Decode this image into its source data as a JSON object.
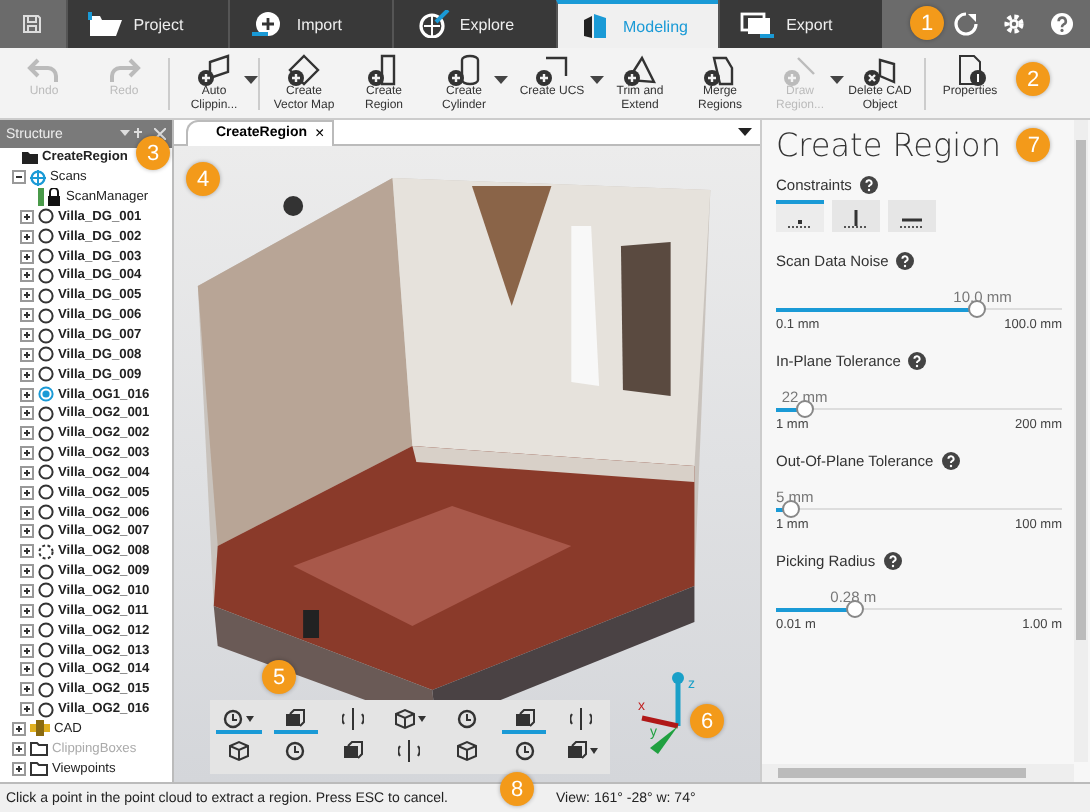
{
  "nav": {
    "tabs": [
      {
        "label": "Project",
        "selected": false
      },
      {
        "label": "Import",
        "selected": false
      },
      {
        "label": "Explore",
        "selected": false
      },
      {
        "label": "Modeling",
        "selected": true
      },
      {
        "label": "Export",
        "selected": false
      }
    ],
    "badge": "1"
  },
  "ribbon": {
    "buttons": [
      {
        "label": "Undo",
        "disabled": true,
        "dropdown": false
      },
      {
        "label": "Redo",
        "disabled": true,
        "dropdown": false
      },
      {
        "label": "Auto Clippin...",
        "disabled": false,
        "dropdown": true
      },
      {
        "label": "Create Vector Map",
        "disabled": false,
        "dropdown": false
      },
      {
        "label": "Create Region",
        "disabled": false,
        "dropdown": false
      },
      {
        "label": "Create Cylinder",
        "disabled": false,
        "dropdown": true
      },
      {
        "label": "Create UCS",
        "disabled": false,
        "dropdown": true
      },
      {
        "label": "Trim and Extend",
        "disabled": false,
        "dropdown": false
      },
      {
        "label": "Merge Regions",
        "disabled": false,
        "dropdown": false
      },
      {
        "label": "Draw Region...",
        "disabled": true,
        "dropdown": true
      },
      {
        "label": "Delete CAD Object",
        "disabled": false,
        "dropdown": false
      },
      {
        "label": "Properties",
        "disabled": false,
        "dropdown": false
      }
    ],
    "badge": "2"
  },
  "structure": {
    "title": "Structure",
    "badge": "3",
    "tree": [
      {
        "label": "CreateRegion",
        "kind": "root",
        "children": [
          {
            "label": "Scans",
            "kind": "group",
            "expanded": true,
            "children": [
              {
                "label": "ScanManager",
                "kind": "manager"
              },
              {
                "label": "Villa_DG_001",
                "kind": "scan",
                "selected": false,
                "loaded": true,
                "expanded": false
              },
              {
                "label": "Villa_DG_002",
                "kind": "scan",
                "selected": false,
                "loaded": true,
                "expanded": false
              },
              {
                "label": "Villa_DG_003",
                "kind": "scan",
                "selected": false,
                "loaded": true,
                "expanded": false
              },
              {
                "label": "Villa_DG_004",
                "kind": "scan",
                "selected": false,
                "loaded": true,
                "expanded": false
              },
              {
                "label": "Villa_DG_005",
                "kind": "scan",
                "selected": false,
                "loaded": true,
                "expanded": false
              },
              {
                "label": "Villa_DG_006",
                "kind": "scan",
                "selected": false,
                "loaded": true,
                "expanded": false
              },
              {
                "label": "Villa_DG_007",
                "kind": "scan",
                "selected": false,
                "loaded": true,
                "expanded": false
              },
              {
                "label": "Villa_DG_008",
                "kind": "scan",
                "selected": false,
                "loaded": true,
                "expanded": false
              },
              {
                "label": "Villa_DG_009",
                "kind": "scan",
                "selected": false,
                "loaded": true,
                "expanded": false
              },
              {
                "label": "Villa_OG1_016",
                "kind": "scan",
                "selected": true,
                "loaded": true,
                "expanded": false
              },
              {
                "label": "Villa_OG2_001",
                "kind": "scan",
                "selected": false,
                "loaded": true,
                "expanded": false
              },
              {
                "label": "Villa_OG2_002",
                "kind": "scan",
                "selected": false,
                "loaded": true,
                "expanded": false
              },
              {
                "label": "Villa_OG2_003",
                "kind": "scan",
                "selected": false,
                "loaded": true,
                "expanded": false
              },
              {
                "label": "Villa_OG2_004",
                "kind": "scan",
                "selected": false,
                "loaded": true,
                "expanded": false
              },
              {
                "label": "Villa_OG2_005",
                "kind": "scan",
                "selected": false,
                "loaded": true,
                "expanded": false
              },
              {
                "label": "Villa_OG2_006",
                "kind": "scan",
                "selected": false,
                "loaded": true,
                "expanded": false
              },
              {
                "label": "Villa_OG2_007",
                "kind": "scan",
                "selected": false,
                "loaded": true,
                "expanded": false
              },
              {
                "label": "Villa_OG2_008",
                "kind": "scan",
                "selected": false,
                "loaded": false,
                "expanded": false
              },
              {
                "label": "Villa_OG2_009",
                "kind": "scan",
                "selected": false,
                "loaded": true,
                "expanded": false
              },
              {
                "label": "Villa_OG2_010",
                "kind": "scan",
                "selected": false,
                "loaded": true,
                "expanded": false
              },
              {
                "label": "Villa_OG2_011",
                "kind": "scan",
                "selected": false,
                "loaded": true,
                "expanded": false
              },
              {
                "label": "Villa_OG2_012",
                "kind": "scan",
                "selected": false,
                "loaded": true,
                "expanded": false
              },
              {
                "label": "Villa_OG2_013",
                "kind": "scan",
                "selected": false,
                "loaded": true,
                "expanded": false
              },
              {
                "label": "Villa_OG2_014",
                "kind": "scan",
                "selected": false,
                "loaded": true,
                "expanded": false
              },
              {
                "label": "Villa_OG2_015",
                "kind": "scan",
                "selected": false,
                "loaded": true,
                "expanded": false
              },
              {
                "label": "Villa_OG2_016",
                "kind": "scan",
                "selected": false,
                "loaded": true,
                "expanded": false
              }
            ]
          },
          {
            "label": "CAD",
            "kind": "cad",
            "expanded": false
          },
          {
            "label": "ClippingBoxes",
            "kind": "folder",
            "expanded": false,
            "disabled": true
          },
          {
            "label": "Viewpoints",
            "kind": "folder",
            "expanded": false
          }
        ]
      }
    ]
  },
  "viewport": {
    "tab": {
      "label": "CreateRegion",
      "close": "×"
    },
    "badge": "4",
    "toolbar_badge": "5",
    "axes_badge": "6",
    "axes": {
      "x": "x",
      "y": "y",
      "z": "z"
    },
    "tools": [
      {
        "active": true,
        "dropdown": true
      },
      {
        "active": true,
        "dropdown": false
      },
      {
        "active": false,
        "dropdown": false
      },
      {
        "active": false,
        "dropdown": true
      },
      {
        "active": false,
        "dropdown": false
      },
      {
        "active": true,
        "dropdown": false
      },
      {
        "active": false,
        "dropdown": false
      },
      {
        "active": false,
        "dropdown": false
      },
      {
        "active": false,
        "dropdown": false
      },
      {
        "active": false,
        "dropdown": false
      },
      {
        "active": false,
        "dropdown": false
      },
      {
        "active": false,
        "dropdown": false
      },
      {
        "active": false,
        "dropdown": false
      },
      {
        "active": false,
        "dropdown": true
      }
    ]
  },
  "panel": {
    "title": "Create Region",
    "badge": "7",
    "constraints": {
      "label": "Constraints",
      "options": [
        {
          "selected": true
        },
        {
          "selected": false
        },
        {
          "selected": false
        }
      ]
    },
    "sliders": [
      {
        "label": "Scan Data Noise",
        "reading": "10.0 mm",
        "level": 0.7,
        "min": "0.1 mm",
        "max": "100.0 mm"
      },
      {
        "label": "In-Plane Tolerance",
        "reading": "22 mm",
        "level": 0.1,
        "min": "1 mm",
        "max": "200 mm"
      },
      {
        "label": "Out-Of-Plane Tolerance",
        "reading": "5 mm",
        "level": 0.05,
        "min": "1 mm",
        "max": "100 mm"
      },
      {
        "label": "Picking Radius",
        "reading": "0.28 m",
        "level": 0.27,
        "min": "0.01 m",
        "max": "1.00 m"
      }
    ]
  },
  "status_bar": {
    "message": "Click a point in the point cloud to extract a region. Press ESC to cancel.",
    "view": "View: 161° -28° w: 74°",
    "badge": "8"
  }
}
